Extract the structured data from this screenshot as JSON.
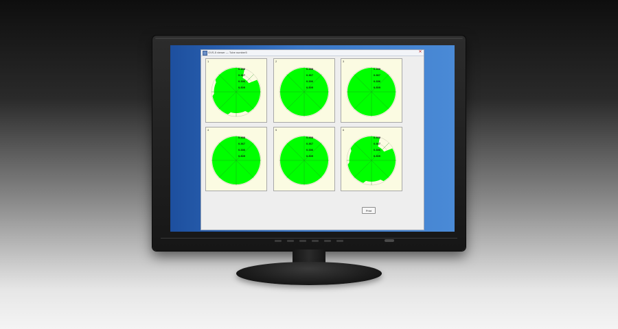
{
  "window": {
    "title": "GVS-5 viewer — Tube number5",
    "close_glyph": "✕"
  },
  "panels": [
    {
      "number": "1",
      "ring_labels": [
        "0.398",
        "0.367",
        "0.336",
        "0.305"
      ],
      "shape": "notched"
    },
    {
      "number": "2",
      "ring_labels": [
        "0.398",
        "0.367",
        "0.336",
        "0.305"
      ],
      "shape": "full"
    },
    {
      "number": "3",
      "ring_labels": [
        "0.398",
        "0.367",
        "0.336",
        "0.305"
      ],
      "shape": "full"
    },
    {
      "number": "4",
      "ring_labels": [
        "0.398",
        "0.367",
        "0.336",
        "0.305"
      ],
      "shape": "full"
    },
    {
      "number": "5",
      "ring_labels": [
        "0.398",
        "0.367",
        "0.336",
        "0.305"
      ],
      "shape": "full"
    },
    {
      "number": "6",
      "ring_labels": [
        "0.398",
        "0.367",
        "0.336",
        "0.305"
      ],
      "shape": "notched"
    }
  ],
  "print_label": "Print",
  "colors": {
    "fill": "#00ff00",
    "panel_bg": "#fbfbe2",
    "desktop": "#3a78c9"
  }
}
